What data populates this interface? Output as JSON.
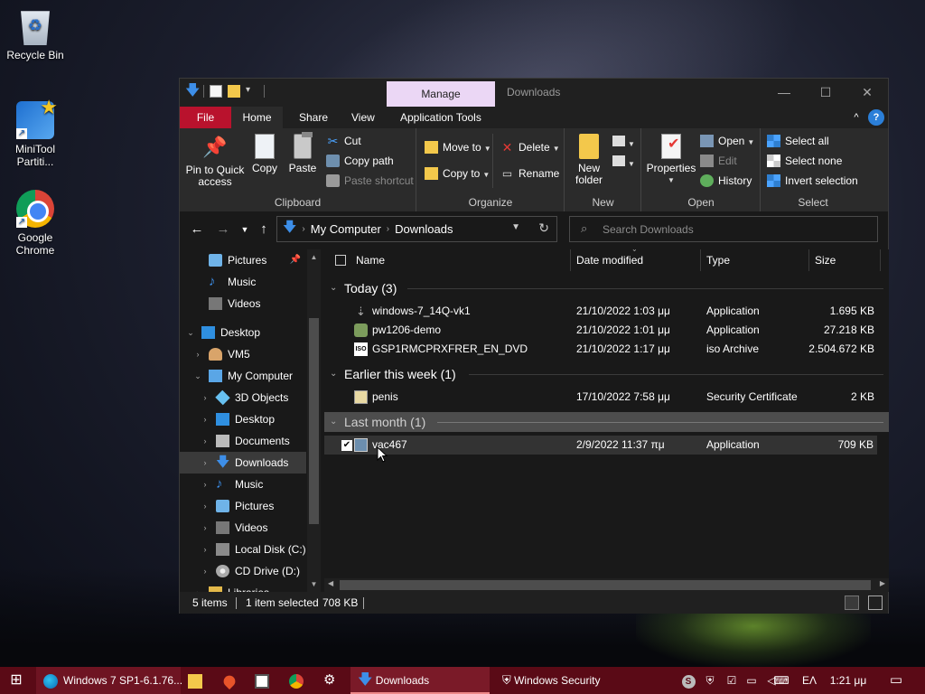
{
  "desktop": {
    "icons": [
      {
        "label": "Recycle Bin"
      },
      {
        "label": "MiniTool Partiti..."
      },
      {
        "label": "Google Chrome"
      }
    ]
  },
  "window": {
    "title": "Downloads",
    "context_tab": "Manage",
    "controls": {
      "minimize": "—",
      "maximize": "☐",
      "close": "✕"
    }
  },
  "ribbon": {
    "tabs": {
      "file": "File",
      "home": "Home",
      "share": "Share",
      "view": "View",
      "app_tools": "Application Tools"
    },
    "collapse": "^",
    "help": "?",
    "clipboard": {
      "label": "Clipboard",
      "pin": "Pin to Quick access",
      "copy": "Copy",
      "paste": "Paste",
      "cut": "Cut",
      "copy_path": "Copy path",
      "paste_shortcut": "Paste shortcut"
    },
    "organize": {
      "label": "Organize",
      "move_to": "Move to",
      "copy_to": "Copy to",
      "delete": "Delete",
      "rename": "Rename"
    },
    "new": {
      "label": "New",
      "new_folder": "New folder"
    },
    "open": {
      "label": "Open",
      "properties": "Properties",
      "open": "Open",
      "edit": "Edit",
      "history": "History"
    },
    "select": {
      "label": "Select",
      "select_all": "Select all",
      "select_none": "Select none",
      "invert": "Invert selection"
    }
  },
  "address": {
    "crumbs": [
      "My Computer",
      "Downloads"
    ],
    "search_placeholder": "Search Downloads"
  },
  "nav_pane": {
    "items": [
      {
        "label": "Pictures",
        "icon": "pictures-icon",
        "pinned": true
      },
      {
        "label": "Music",
        "icon": "music-icon"
      },
      {
        "label": "Videos",
        "icon": "videos-icon"
      },
      {
        "label": "Desktop",
        "icon": "desktop-icon",
        "expanded": true
      },
      {
        "label": "VM5",
        "icon": "user-icon"
      },
      {
        "label": "My Computer",
        "icon": "computer-icon",
        "expanded": true
      },
      {
        "label": "3D Objects",
        "icon": "3d-objects-icon"
      },
      {
        "label": "Desktop",
        "icon": "desktop-icon"
      },
      {
        "label": "Documents",
        "icon": "documents-icon"
      },
      {
        "label": "Downloads",
        "icon": "downloads-icon",
        "selected": true
      },
      {
        "label": "Music",
        "icon": "music-icon"
      },
      {
        "label": "Pictures",
        "icon": "pictures-icon"
      },
      {
        "label": "Videos",
        "icon": "videos-icon"
      },
      {
        "label": "Local Disk (C:)",
        "icon": "disk-icon"
      },
      {
        "label": "CD Drive (D:)",
        "icon": "cd-drive-icon"
      },
      {
        "label": "Libraries",
        "icon": "libraries-icon"
      }
    ]
  },
  "file_list": {
    "columns": {
      "name": "Name",
      "date": "Date modified",
      "type": "Type",
      "size": "Size"
    },
    "groups": [
      {
        "title": "Today (3)",
        "files": [
          {
            "name": "windows-7_14Q-vk1",
            "date": "21/10/2022 1:03 μμ",
            "type": "Application",
            "size": "1.695 KB",
            "icon": "download-file-icon"
          },
          {
            "name": "pw1206-demo",
            "date": "21/10/2022 1:01 μμ",
            "type": "Application",
            "size": "27.218 KB",
            "icon": "application-icon"
          },
          {
            "name": "GSP1RMCPRXFRER_EN_DVD",
            "date": "21/10/2022 1:17 μμ",
            "type": "iso Archive",
            "size": "2.504.672 KB",
            "icon": "iso-icon"
          }
        ]
      },
      {
        "title": "Earlier this week (1)",
        "files": [
          {
            "name": "penis",
            "date": "17/10/2022 7:58 μμ",
            "type": "Security Certificate",
            "size": "2 KB",
            "icon": "certificate-icon"
          }
        ]
      },
      {
        "title": "Last month (1)",
        "files": [
          {
            "name": "vac467",
            "date": "2/9/2022 11:37 πμ",
            "type": "Application",
            "size": "709 KB",
            "icon": "application-icon",
            "selected": true
          }
        ]
      }
    ],
    "iso_badge": "ISO"
  },
  "status": {
    "items": "5 items",
    "selected": "1 item selected",
    "size": "708 KB"
  },
  "taskbar": {
    "items": [
      {
        "label": "Windows 7 SP1-6.1.76...",
        "icon": "edge-icon"
      },
      {
        "label": "Downloads",
        "icon": "downloads-icon",
        "active": true
      },
      {
        "label": "Windows Security",
        "icon": "shield-icon"
      }
    ],
    "language": "ΕΛ",
    "time": "1:21 μμ"
  }
}
